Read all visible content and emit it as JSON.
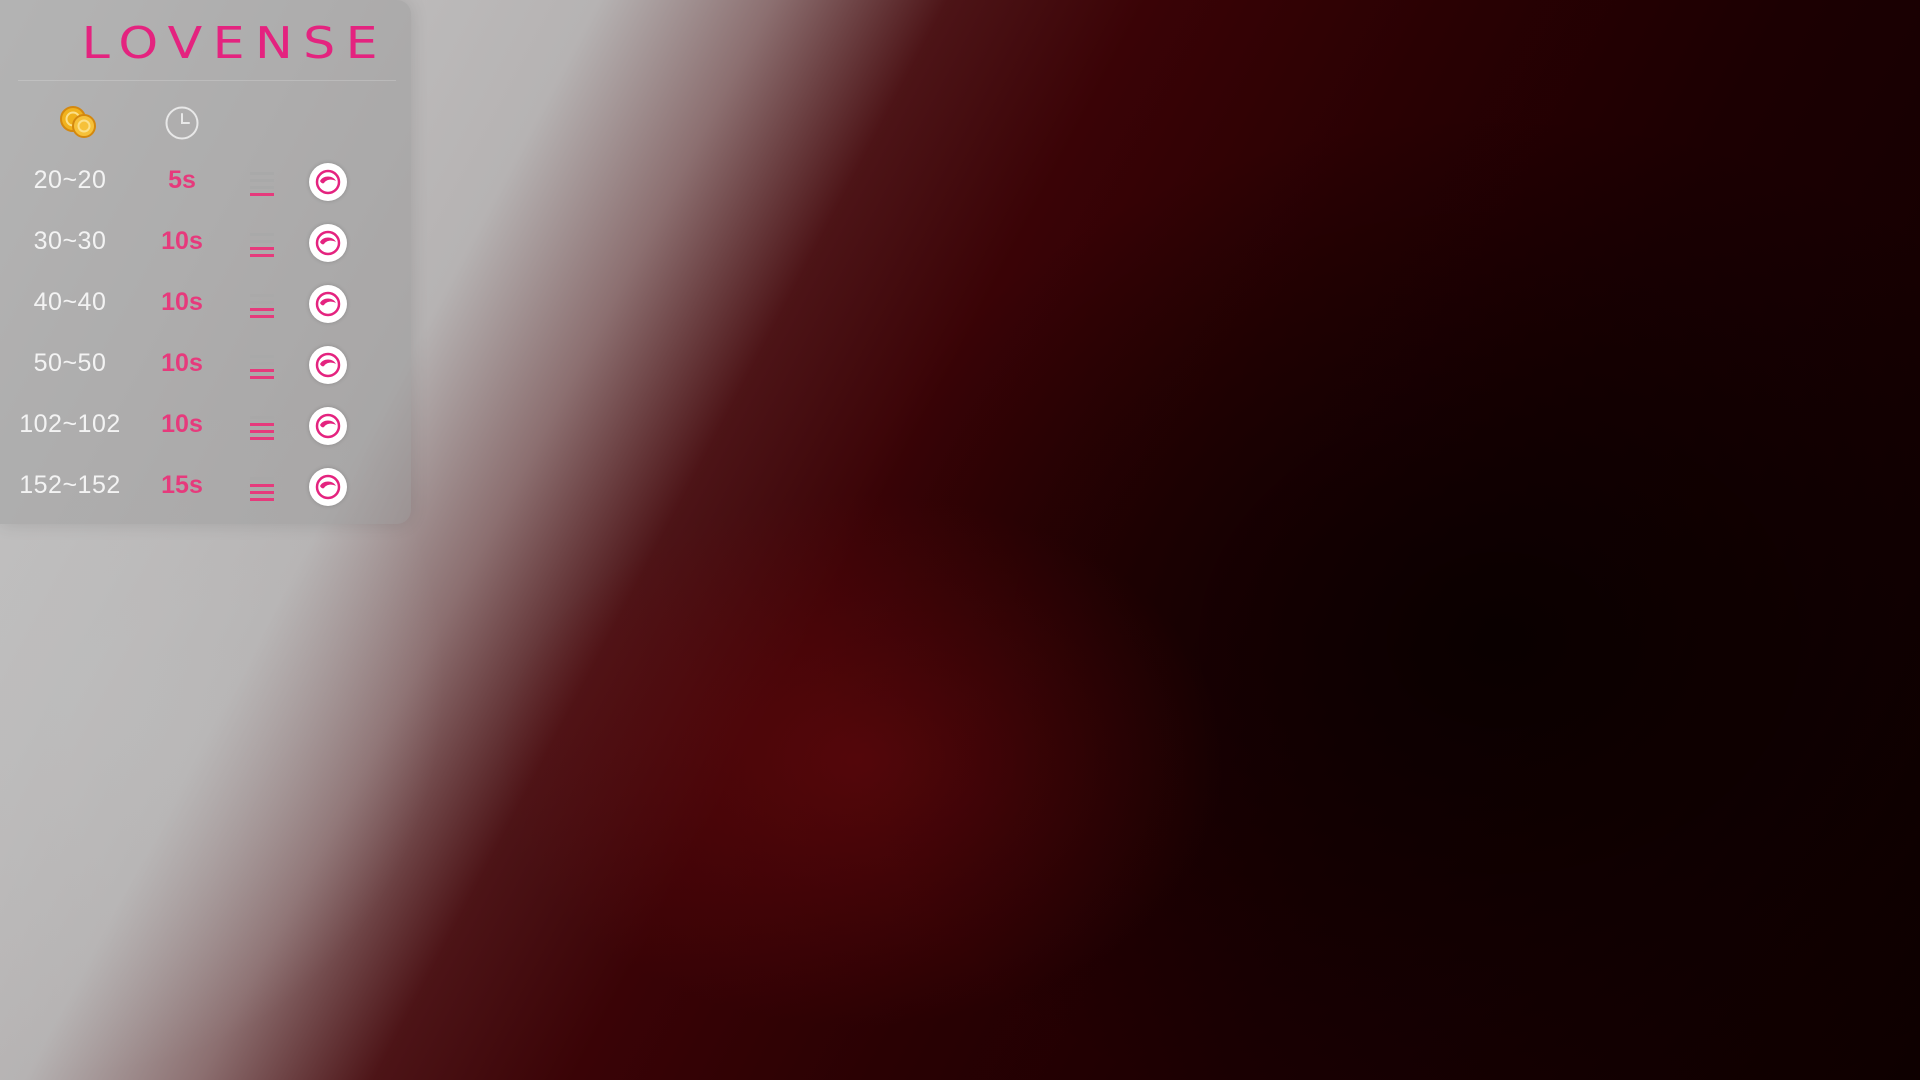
{
  "brand": {
    "name": "LOVENSE",
    "color": "#e4237f"
  },
  "header": {
    "tokens_icon": "coins-icon",
    "duration_icon": "clock-icon"
  },
  "levels": [
    {
      "range": "20~20",
      "duration": "5s",
      "intensity": "low",
      "action_icon": "vibrate-toy-icon"
    },
    {
      "range": "30~30",
      "duration": "10s",
      "intensity": "medium",
      "action_icon": "vibrate-toy-icon"
    },
    {
      "range": "40~40",
      "duration": "10s",
      "intensity": "medium",
      "action_icon": "vibrate-toy-icon"
    },
    {
      "range": "50~50",
      "duration": "10s",
      "intensity": "medium",
      "action_icon": "vibrate-toy-icon"
    },
    {
      "range": "102~102",
      "duration": "10s",
      "intensity": "high",
      "action_icon": "vibrate-toy-icon"
    },
    {
      "range": "152~152",
      "duration": "15s",
      "intensity": "high",
      "action_icon": "vibrate-toy-icon"
    }
  ],
  "colors": {
    "accent": "#e63a7c",
    "coin": "#f0b21e",
    "panel_text": "#f3f3f3"
  }
}
